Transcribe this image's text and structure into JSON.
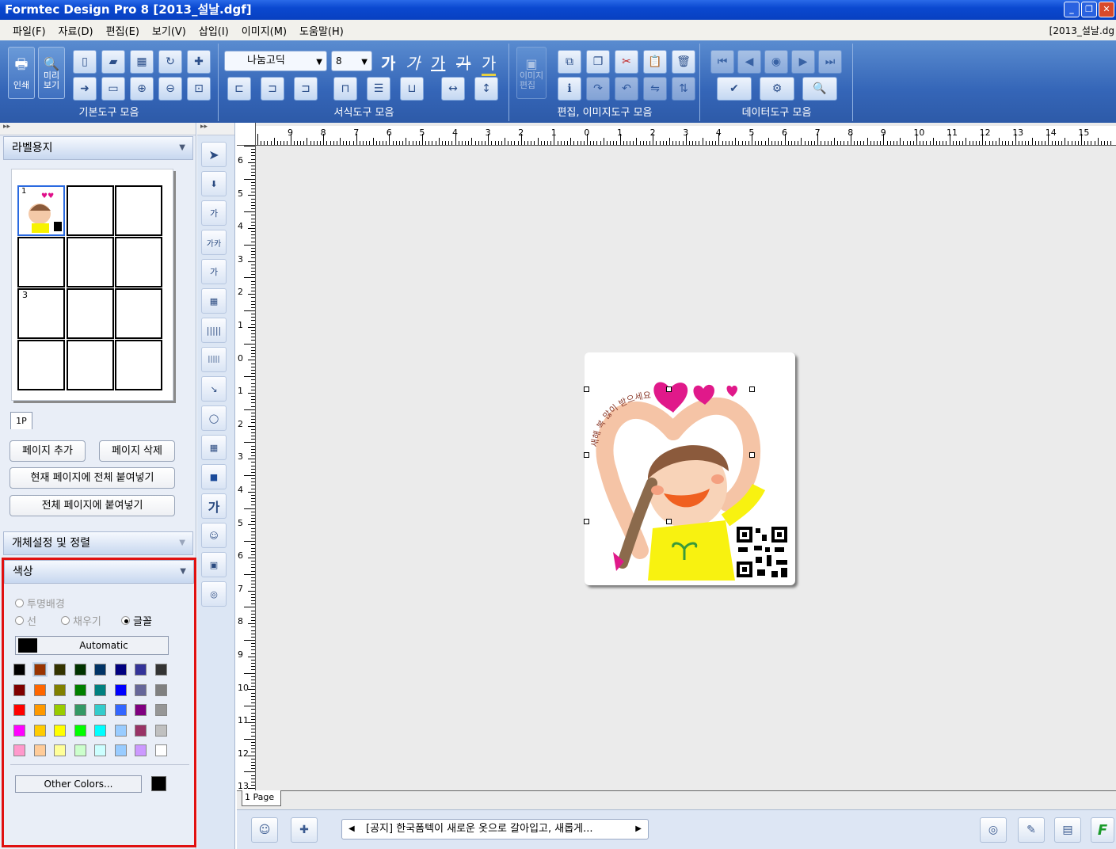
{
  "window": {
    "title": "Formtec Design Pro 8 [2013_설날.dgf]",
    "app_icon": "8",
    "doc_name": "[2013_설날.dg"
  },
  "menu": [
    "파일(F)",
    "자료(D)",
    "편집(E)",
    "보기(V)",
    "삽입(I)",
    "이미지(M)",
    "도움말(H)"
  ],
  "ribbon": {
    "print_label": "인쇄",
    "preview_label": "미리\n보기",
    "basic_group": "기본도구 모음",
    "font_name": "나눔고딕",
    "font_size": "8",
    "format_group": "서식도구 모음",
    "image_edit_label": "이미지\n편집",
    "edit_group": "편집, 이미지도구 모음",
    "data_group": "데이터도구 모음",
    "font_style_glyphs": [
      "가",
      "가",
      "가",
      "가",
      "가"
    ]
  },
  "left_panel": {
    "label_paper_header": "라벨용지",
    "cell_numbers": [
      "1",
      "3"
    ],
    "page_tab": "1P",
    "add_page": "페이지 추가",
    "delete_page": "페이지 삭제",
    "paste_current": "현재 페이지에 전체 붙여넣기",
    "paste_all": "전체 페이지에 붙여넣기",
    "object_settings": "개체설정 및 정렬",
    "color_header": "색상",
    "transparent_bg": "투명배경",
    "line": "선",
    "fill": "채우기",
    "font": "글꼴",
    "automatic": "Automatic",
    "other_colors": "Other Colors...",
    "palette": [
      [
        "#000000",
        "#993300",
        "#333300",
        "#003300",
        "#003366",
        "#000080",
        "#333399",
        "#333333"
      ],
      [
        "#800000",
        "#FF6600",
        "#808000",
        "#008000",
        "#008080",
        "#0000FF",
        "#666699",
        "#808080"
      ],
      [
        "#FF0000",
        "#FF9900",
        "#99CC00",
        "#339966",
        "#33CCCC",
        "#3366FF",
        "#800080",
        "#969696"
      ],
      [
        "#FF00FF",
        "#FFCC00",
        "#FFFF00",
        "#00FF00",
        "#00FFFF",
        "#99CCFF",
        "#993366",
        "#C0C0C0"
      ],
      [
        "#FF99CC",
        "#FFCC99",
        "#FFFF99",
        "#CCFFCC",
        "#CCFFFF",
        "#99CCFF",
        "#CC99FF",
        "#FFFFFF"
      ]
    ]
  },
  "canvas": {
    "ruler_top": [
      "9",
      "8",
      "7",
      "6",
      "5",
      "4",
      "3",
      "2",
      "1",
      "0",
      "1",
      "2",
      "3",
      "4",
      "5",
      "6",
      "7",
      "8",
      "9",
      "10",
      "11",
      "12",
      "13",
      "14",
      "15"
    ],
    "ruler_left": [
      "6",
      "5",
      "4",
      "3",
      "2",
      "1",
      "0",
      "1",
      "2",
      "3",
      "4",
      "5",
      "6",
      "7",
      "8",
      "9",
      "10",
      "11",
      "12",
      "13"
    ],
    "label_text": "새해 복 많이 받으세요.",
    "page_tab": "1 Page"
  },
  "status": {
    "notice": "[공지] 한국폼텍이 새로운 옷으로 갈아입고, 새롭게..."
  }
}
